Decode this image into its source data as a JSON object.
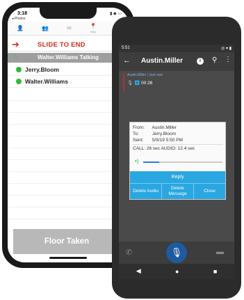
{
  "iphone": {
    "status": {
      "time": "3:18",
      "back_label": "◂ Photos",
      "right_icons": "▮ ◆ ▭"
    },
    "toolbar": [
      {
        "icon": "person-icon",
        "glyph": "👤",
        "label": "",
        "active": false
      },
      {
        "icon": "group-icon",
        "glyph": "👥",
        "label": "",
        "active": false
      },
      {
        "icon": "message-icon",
        "glyph": "✉",
        "label": "",
        "active": false
      },
      {
        "icon": "location-icon",
        "glyph": "📍",
        "label": "Map",
        "active": false
      },
      {
        "icon": "talk-icon",
        "glyph": "•)",
        "label": "Call",
        "active": true
      }
    ],
    "slide_text": "SLIDE TO END",
    "talking_text": "Walter.Williams Talking",
    "users": [
      {
        "name": "Jerry.Bloom"
      },
      {
        "name": "Walter.Williams"
      }
    ],
    "floor_button": "Floor Taken"
  },
  "android": {
    "status": {
      "time": "5:51",
      "right": "◎ ▾ ▮"
    },
    "title": "Austin.Miller",
    "message": {
      "from": "Austin.Miller | Just now",
      "duration": "00:26"
    },
    "dialog": {
      "from_label": "From:",
      "from": "Austin.Miller",
      "to_label": "To:",
      "to": "Jerry.Bloom",
      "sent_label": "Sent:",
      "sent": "5/9/19 5:50 PM",
      "call_info": "CALL: 26 sec AUDIO: 12.4 sec",
      "progress": 0.2,
      "reply": "Reply",
      "delete_audio": "Delete Audio",
      "delete_message_1": "Delete",
      "delete_message_2": "Message",
      "close": "Close"
    }
  },
  "colors": {
    "accent_green": "#3ab53a",
    "alert_red": "#d62b1e",
    "action_blue": "#2aa7e0"
  }
}
